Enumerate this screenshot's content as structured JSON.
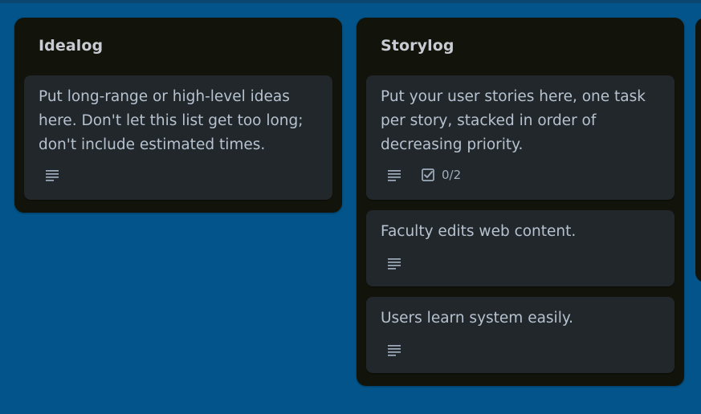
{
  "board": {
    "background_color": "#02548a",
    "list_color": "#12130a",
    "card_color": "#22272b",
    "lists": [
      {
        "title": "Idealog",
        "cards": [
          {
            "text": "Put long-range or high-level ideas\nhere. Don't let this list get too long;\ndon't include estimated times.",
            "has_description_icon": true
          }
        ]
      },
      {
        "title": "Storylog",
        "cards": [
          {
            "text": "Put your user stories here, one task\nper story, stacked in order of\ndecreasing priority.",
            "has_description_icon": true,
            "checklist": "0/2"
          },
          {
            "text": "Faculty edits web content.",
            "has_description_icon": true
          },
          {
            "text": "Users learn system easily.",
            "has_description_icon": true
          }
        ]
      }
    ]
  },
  "icons": {
    "description": "description-icon",
    "checklist": "checklist-icon"
  }
}
